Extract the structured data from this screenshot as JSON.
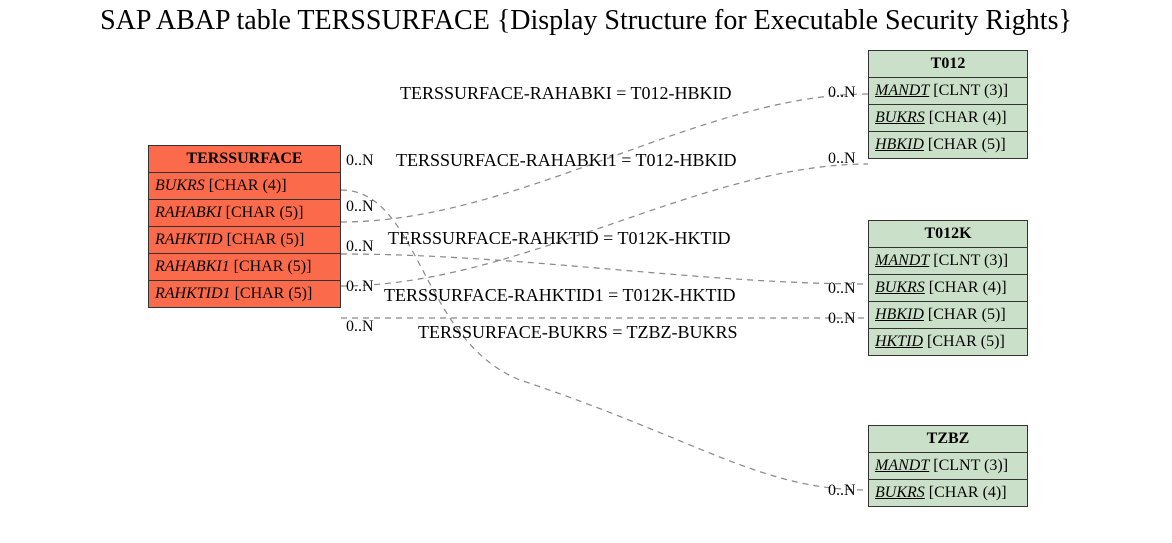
{
  "title": "SAP ABAP table TERSSURFACE {Display Structure for Executable Security Rights}",
  "entities": {
    "main": {
      "name": "TERSSURFACE",
      "fields": [
        {
          "name": "BUKRS",
          "type": "[CHAR (4)]",
          "key": false
        },
        {
          "name": "RAHABKI",
          "type": "[CHAR (5)]",
          "key": false
        },
        {
          "name": "RAHKTID",
          "type": "[CHAR (5)]",
          "key": false
        },
        {
          "name": "RAHABKI1",
          "type": "[CHAR (5)]",
          "key": false
        },
        {
          "name": "RAHKTID1",
          "type": "[CHAR (5)]",
          "key": false
        }
      ]
    },
    "t012": {
      "name": "T012",
      "fields": [
        {
          "name": "MANDT",
          "type": "[CLNT (3)]",
          "key": true
        },
        {
          "name": "BUKRS",
          "type": "[CHAR (4)]",
          "key": true
        },
        {
          "name": "HBKID",
          "type": "[CHAR (5)]",
          "key": true
        }
      ]
    },
    "t012k": {
      "name": "T012K",
      "fields": [
        {
          "name": "MANDT",
          "type": "[CLNT (3)]",
          "key": true
        },
        {
          "name": "BUKRS",
          "type": "[CHAR (4)]",
          "key": true
        },
        {
          "name": "HBKID",
          "type": "[CHAR (5)]",
          "key": true
        },
        {
          "name": "HKTID",
          "type": "[CHAR (5)]",
          "key": true
        }
      ]
    },
    "tzbz": {
      "name": "TZBZ",
      "fields": [
        {
          "name": "MANDT",
          "type": "[CLNT (3)]",
          "key": true
        },
        {
          "name": "BUKRS",
          "type": "[CHAR (4)]",
          "key": true
        }
      ]
    }
  },
  "edges": {
    "e1": {
      "label": "TERSSURFACE-RAHABKI = T012-HBKID",
      "left_card": "0..N",
      "right_card": "0..N"
    },
    "e2": {
      "label": "TERSSURFACE-RAHABKI1 = T012-HBKID",
      "left_card": "0..N",
      "right_card": "0..N"
    },
    "e3": {
      "label": "TERSSURFACE-RAHKTID = T012K-HKTID",
      "left_card": "0..N",
      "right_card": "0..N"
    },
    "e4": {
      "label": "TERSSURFACE-RAHKTID1 = T012K-HKTID",
      "left_card": "0..N",
      "right_card": "0..N"
    },
    "e5": {
      "label": "TERSSURFACE-BUKRS = TZBZ-BUKRS",
      "left_card": "0..N",
      "right_card": "0..N"
    }
  }
}
